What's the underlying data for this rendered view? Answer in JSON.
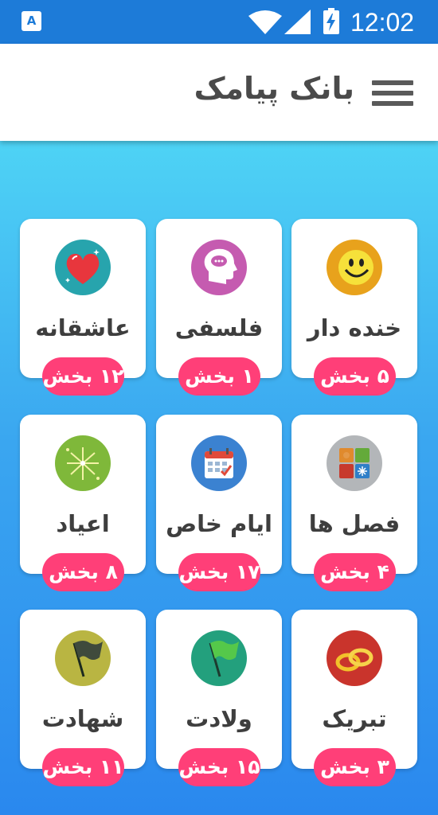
{
  "status_bar": {
    "app_icon_letter": "A",
    "time": "12:02",
    "icons": [
      "app-notification-icon",
      "wifi-icon",
      "signal-icon",
      "battery-charging-icon"
    ]
  },
  "toolbar": {
    "title": "بانک پیامک",
    "menu_icon": "hamburger-menu-icon"
  },
  "colors": {
    "status_bar": "#1d7bd8",
    "gradient_top": "#4ed3f5",
    "gradient_bottom": "#2a88ee",
    "badge": "#ff3f78"
  },
  "categories": [
    {
      "label": "خنده دار",
      "count": "۵ بخش",
      "icon": "smiley-face-icon"
    },
    {
      "label": "فلسفی",
      "count": "۱ بخش",
      "icon": "thinking-head-icon"
    },
    {
      "label": "عاشقانه",
      "count": "۱۲ بخش",
      "icon": "heart-icon"
    },
    {
      "label": "فصل ها",
      "count": "۴ بخش",
      "icon": "four-seasons-icon"
    },
    {
      "label": "ایام خاص",
      "count": "۱۷ بخش",
      "icon": "calendar-icon"
    },
    {
      "label": "اعیاد",
      "count": "۸ بخش",
      "icon": "fireworks-icon"
    },
    {
      "label": "تبریک",
      "count": "۳ بخش",
      "icon": "rings-icon"
    },
    {
      "label": "ولادت",
      "count": "۱۵ بخش",
      "icon": "green-flag-icon"
    },
    {
      "label": "شهادت",
      "count": "۱۱ بخش",
      "icon": "dark-flag-icon"
    }
  ]
}
